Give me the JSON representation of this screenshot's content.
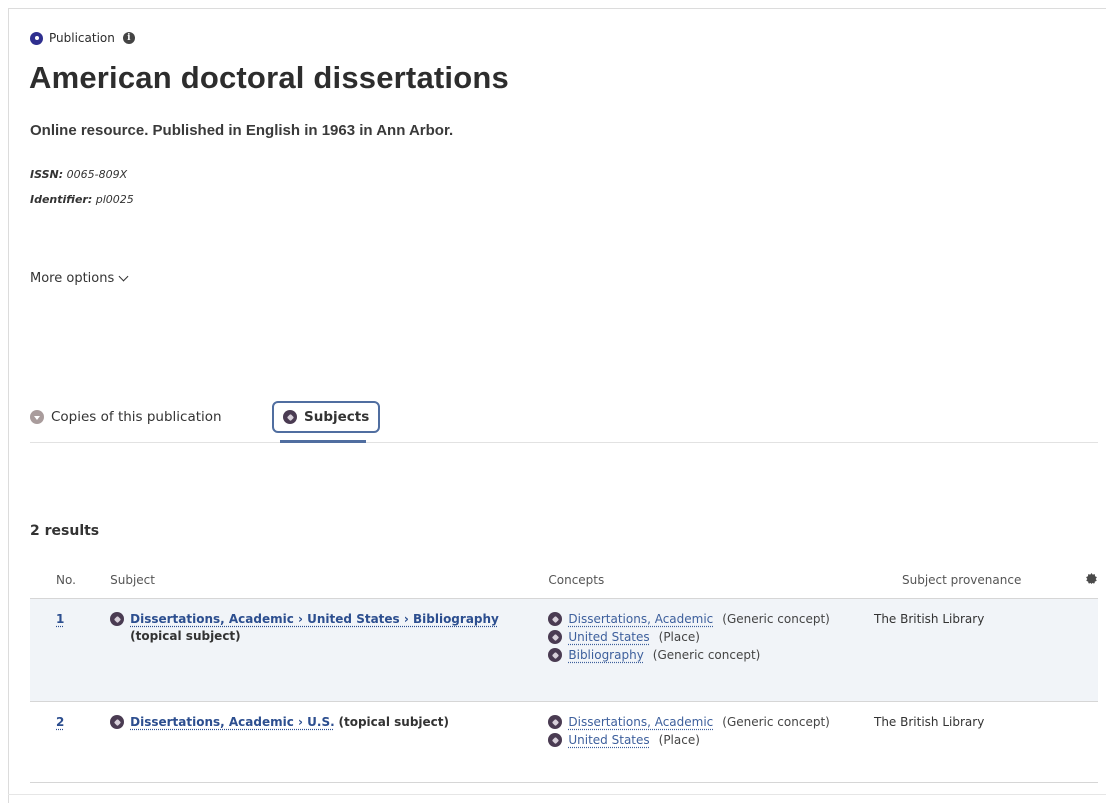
{
  "header": {
    "type_label": "Publication",
    "title": "American doctoral dissertations",
    "description": "Online resource. Published in English in 1963 in Ann Arbor.",
    "issn_label": "ISSN:",
    "issn_value": "0065-809X",
    "identifier_label": "Identifier:",
    "identifier_value": "pl0025",
    "more_options": "More options"
  },
  "tabs": [
    {
      "label": "Copies of this publication",
      "selected": false
    },
    {
      "label": "Subjects",
      "selected": true
    }
  ],
  "results": {
    "count_label": "2 results",
    "columns": {
      "no": "No.",
      "subject": "Subject",
      "concepts": "Concepts",
      "provenance": "Subject provenance"
    },
    "rows": [
      {
        "no": "1",
        "subject": "Dissertations, Academic › United States › Bibliography",
        "subject_type": "(topical subject)",
        "concepts": [
          {
            "name": "Dissertations, Academic",
            "type": "(Generic concept)"
          },
          {
            "name": "United States",
            "type": "(Place)"
          },
          {
            "name": "Bibliography",
            "type": "(Generic concept)"
          }
        ],
        "provenance": "The British Library"
      },
      {
        "no": "2",
        "subject": "Dissertations, Academic › U.S.",
        "subject_type": "(topical subject)",
        "concepts": [
          {
            "name": "Dissertations, Academic",
            "type": "(Generic concept)"
          },
          {
            "name": "United States",
            "type": "(Place)"
          }
        ],
        "provenance": "The British Library"
      }
    ]
  },
  "icons": {
    "publication": "publication-dot-icon",
    "info": "info-icon",
    "chevron": "chevron-down-icon",
    "copies": "copies-icon",
    "subjects": "subject-icon",
    "gear": "gear-icon"
  },
  "colors": {
    "accent": "#2c4e8f",
    "tab_border": "#506ea0",
    "row_highlight": "#f1f4f8"
  }
}
